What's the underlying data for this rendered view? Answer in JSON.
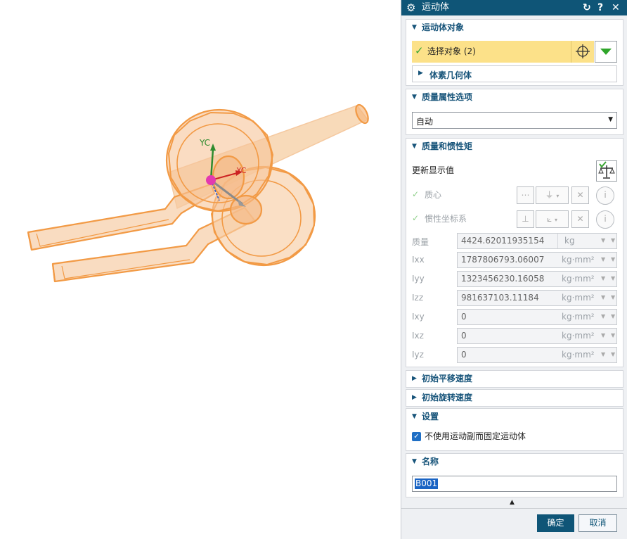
{
  "dialog": {
    "title": "运动体",
    "reset_icon": "reset-icon",
    "help_label": "?",
    "close_label": "✕"
  },
  "sec_objects": {
    "header": "运动体对象",
    "select_label": "选择对象 (2)",
    "subgeometry_label": "体素几何体"
  },
  "sec_mass_options": {
    "header": "质量属性选项",
    "value": "自动"
  },
  "sec_mass_inertia": {
    "header": "质量和惯性矩",
    "update_label": "更新显示值",
    "centroid_label": "质心",
    "inertia_csys_label": "惯性坐标系",
    "fields": [
      {
        "label": "质量",
        "value": "4424.62011935154",
        "unit": "kg"
      },
      {
        "label": "Ixx",
        "value": "1787806793.06007",
        "unit": "kg·mm²"
      },
      {
        "label": "Iyy",
        "value": "1323456230.16058",
        "unit": "kg·mm²"
      },
      {
        "label": "Izz",
        "value": "981637103.11184",
        "unit": "kg·mm²"
      },
      {
        "label": "Ixy",
        "value": "0",
        "unit": "kg·mm²"
      },
      {
        "label": "Ixz",
        "value": "0",
        "unit": "kg·mm²"
      },
      {
        "label": "Iyz",
        "value": "0",
        "unit": "kg·mm²"
      }
    ]
  },
  "sec_init_translation": {
    "header": "初始平移速度"
  },
  "sec_init_rotation": {
    "header": "初始旋转速度"
  },
  "sec_settings": {
    "header": "设置",
    "checkbox_label": "不使用运动副而固定运动体",
    "checked": true
  },
  "sec_name": {
    "header": "名称",
    "value": "B001"
  },
  "footer": {
    "ok_label": "确定",
    "cancel_label": "取消"
  },
  "viewport": {
    "yc_label": "YC",
    "xc_label": "XC",
    "model_color": "#f29a45",
    "fill_color": "#f6c9a0"
  },
  "colors": {
    "titlebar": "#0f5577",
    "section_header": "#17547a",
    "selection_highlight": "#fce189",
    "check_green": "#3aa534"
  }
}
